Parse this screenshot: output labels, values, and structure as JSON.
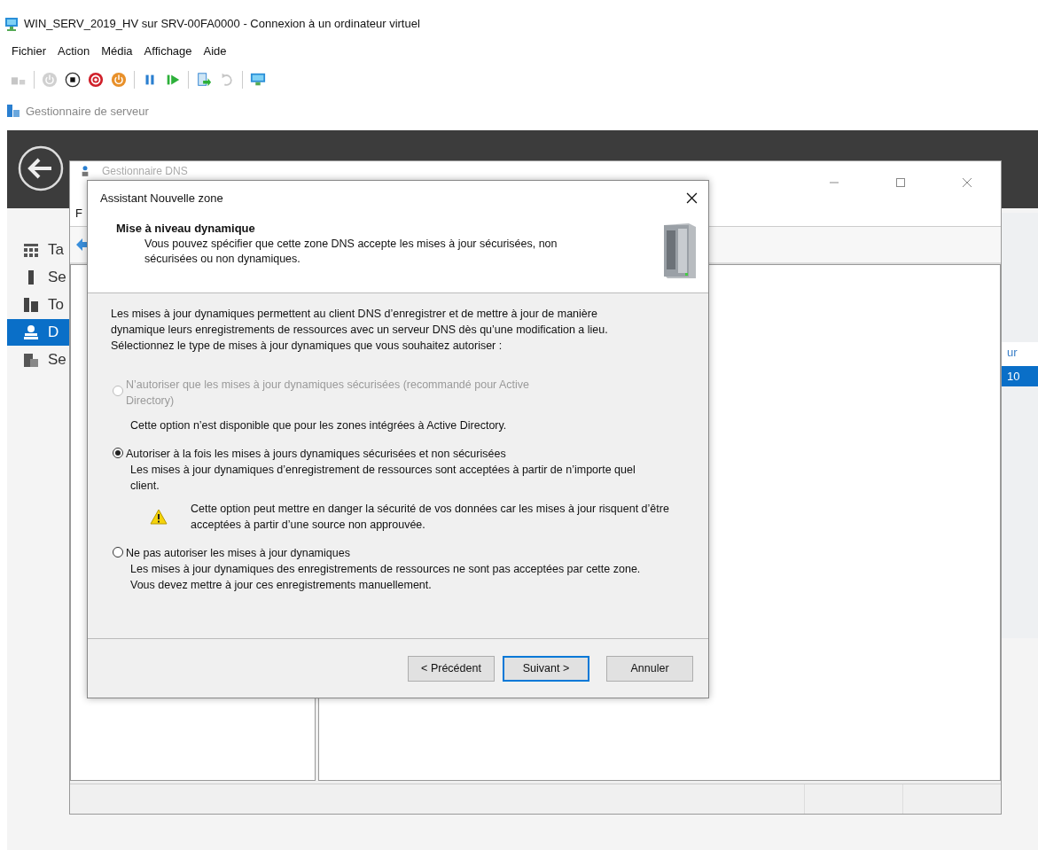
{
  "vm_window": {
    "title": "WIN_SERV_2019_HV sur SRV-00FA0000 - Connexion à un ordinateur virtuel",
    "menu": [
      "Fichier",
      "Action",
      "Média",
      "Affichage",
      "Aide"
    ],
    "toolbar": [
      {
        "kind": "keys",
        "disabled": true
      },
      {
        "kind": "start",
        "disabled": true
      },
      {
        "kind": "turn-off",
        "disabled": false
      },
      {
        "kind": "shut-down",
        "disabled": false
      },
      {
        "kind": "save",
        "disabled": false
      },
      {
        "kind": "pause",
        "disabled": false
      },
      {
        "kind": "resume",
        "disabled": false
      },
      {
        "kind": "checkpoint",
        "disabled": false
      },
      {
        "kind": "revert",
        "disabled": true
      },
      {
        "kind": "session",
        "disabled": false
      }
    ]
  },
  "server_manager": {
    "title": "Gestionnaire de serveur",
    "sidebar": [
      {
        "kind": "dashboard",
        "label": "Ta",
        "selected": false
      },
      {
        "kind": "server",
        "label": "Se",
        "selected": false
      },
      {
        "kind": "servers",
        "label": "To",
        "selected": false
      },
      {
        "kind": "dns",
        "label": "D",
        "selected": true
      },
      {
        "kind": "files",
        "label": "Se",
        "selected": false
      }
    ],
    "column_header": "ur",
    "row_cell": "10"
  },
  "dns_window": {
    "title": "Gestionnaire DNS",
    "menu_item": "F"
  },
  "dialog": {
    "title": "Assistant Nouvelle zone",
    "header_title": "Mise à niveau dynamique",
    "header_text": "Vous pouvez spécifier que cette zone DNS accepte les mises à jour sécurisées, non sécurisées ou non dynamiques.",
    "intro": [
      "Les mises à jour dynamiques permettent au client DNS d’enregistrer et de mettre à jour de manière dynamique leurs enregistrements de ressources avec un serveur DNS dès qu’une modification a lieu.",
      "Sélectionnez le type de mises à jour dynamiques que vous souhaitez autoriser :"
    ],
    "options": [
      {
        "label": "N’autoriser que les mises à jour dynamiques sécurisées (recommandé pour Active Directory)",
        "description": "Cette option n’est disponible que pour les zones intégrées à Active Directory.",
        "selected": false,
        "disabled": true
      },
      {
        "label": "Autoriser à la fois les mises à jours dynamiques sécurisées et non sécurisées",
        "description": "Les mises à jour dynamiques d’enregistrement de ressources sont acceptées à partir de n’importe quel client.",
        "warning": "Cette option peut mettre en danger la sécurité de vos données car les mises à jour risquent d’être acceptées à partir d’une source non approuvée.",
        "selected": true,
        "disabled": false
      },
      {
        "label": "Ne pas autoriser les mises à jour dynamiques",
        "description": "Les mises à jour dynamiques des enregistrements de ressources ne sont pas acceptées par cette zone. Vous devez mettre à jour ces enregistrements manuellement.",
        "selected": false,
        "disabled": false
      }
    ],
    "buttons": [
      {
        "label": "< Précédent",
        "focused": false
      },
      {
        "label": "Suivant >",
        "focused": true
      },
      {
        "label": "Annuler",
        "focused": false
      }
    ]
  }
}
